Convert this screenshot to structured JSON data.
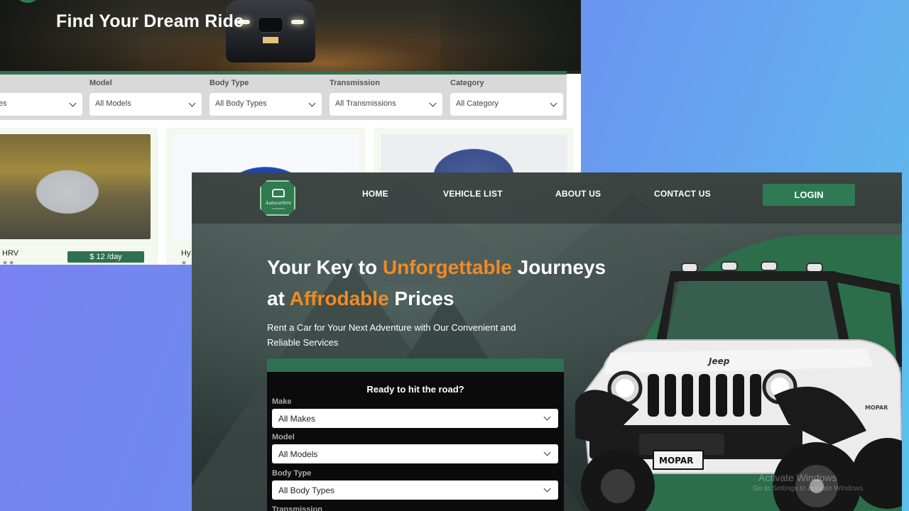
{
  "back_page": {
    "hero_title": "Find Your Dream Ride",
    "filters": [
      {
        "label": "",
        "value": "es"
      },
      {
        "label": "Model",
        "value": "All Models"
      },
      {
        "label": "Body Type",
        "value": "All Body Types"
      },
      {
        "label": "Transmission",
        "value": "All Transmissions"
      },
      {
        "label": "Category",
        "value": "All Category"
      }
    ],
    "cards": [
      {
        "name": "HRV",
        "price": "$ 12 /day",
        "stars": "★★"
      },
      {
        "name": "Hy",
        "price": "",
        "stars": "★"
      },
      {
        "name": "",
        "price": "",
        "stars": ""
      }
    ]
  },
  "front_page": {
    "nav": {
      "logo_text": "Autocarhire",
      "logo_sub": "CAR RENTAL",
      "links": [
        "HOME",
        "VEHICLE LIST",
        "ABOUT US",
        "CONTACT US"
      ],
      "login": "LOGIN"
    },
    "headline": {
      "part1": "Your Key to ",
      "highlight1": "Unforgettable",
      "part2": " Journeys",
      "part3": "at ",
      "highlight2": "Affrodable",
      "part4": " Prices"
    },
    "subtext": "Rent a Car for Your Next Adventure with Our Convenient and Reliable Services",
    "search": {
      "title": "Ready to hit the road?",
      "fields": [
        {
          "label": "Make",
          "value": "All Makes"
        },
        {
          "label": "Model",
          "value": "All Models"
        },
        {
          "label": "Body Type",
          "value": "All Body Types"
        },
        {
          "label": "Transmission",
          "value": ""
        }
      ]
    },
    "jeep_labels": {
      "brand": "Jeep",
      "bumper": "MOPAR",
      "side": "MOPAR"
    },
    "watermark": {
      "title": "Activate Windows",
      "sub": "Go to Settings to activate Windows."
    }
  },
  "colors": {
    "accent_green": "#2e7052",
    "highlight_orange": "#f08a24",
    "background_gradient_start": "#7b7ff2",
    "background_gradient_end": "#5ec0ee"
  }
}
